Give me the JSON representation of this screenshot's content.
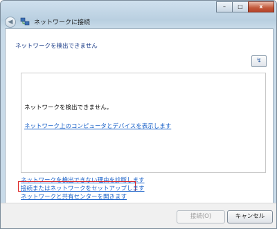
{
  "window": {
    "title": "ネットワークに接続",
    "back_icon": "back-arrow-icon",
    "app_icon": "network-icon",
    "minimize_glyph": "–",
    "maximize_glyph": "□",
    "close_glyph": "x"
  },
  "main": {
    "heading": "ネットワークを検出できません",
    "refresh_glyph": "↯",
    "message": "ネットワークを検出できません。",
    "devices_link": "ネットワーク上のコンピュータとデバイスを表示します"
  },
  "links": {
    "diagnose": "ネットワークを検出できない理由を診断します",
    "setup": "接続またはネットワークをセットアップします",
    "network_center": "ネットワークと共有センターを開きます"
  },
  "footer": {
    "connect_label": "接続(O)",
    "cancel_label": "キャンセル"
  },
  "colors": {
    "link": "#1a62c9",
    "heading": "#1e3f8a",
    "highlight": "#dd2222"
  }
}
